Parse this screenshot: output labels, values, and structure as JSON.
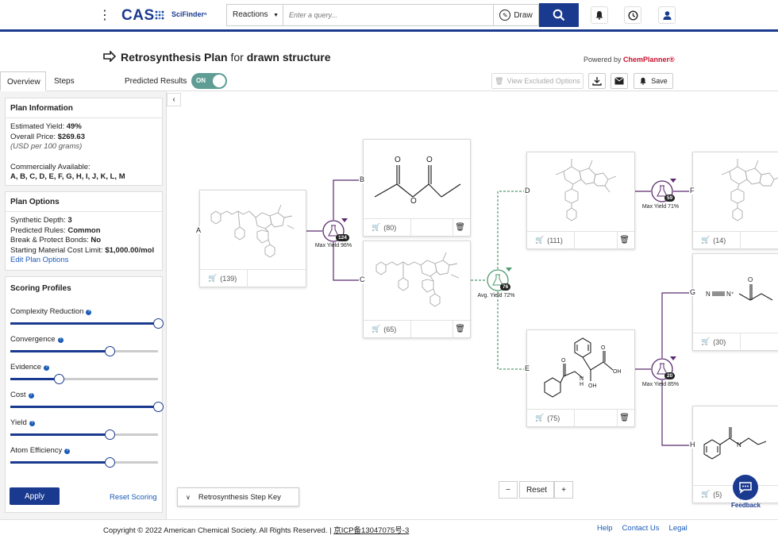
{
  "header": {
    "logo": "CAS",
    "logo_sub": "SciFinderⁿ",
    "search_type": "Reactions",
    "search_placeholder": "Enter a query...",
    "draw_label": "Draw"
  },
  "page": {
    "title_bold": "Retrosynthesis Plan",
    "title_mid": " for ",
    "title_end": "drawn structure",
    "powered_prefix": "Powered by ",
    "powered_brand": "ChemPlanner®"
  },
  "tabs": [
    {
      "label": "Overview"
    },
    {
      "label": "Steps"
    }
  ],
  "toolbar": {
    "predicted_label": "Predicted Results",
    "toggle_label": "ON",
    "view_excluded": "View Excluded Options",
    "save_label": "Save"
  },
  "plan_info": {
    "heading": "Plan Information",
    "est_yield_label": "Estimated Yield: ",
    "est_yield": "49%",
    "price_label": "Overall Price: ",
    "price": "$269.63",
    "price_note": "(USD per 100 grams)",
    "commercial_label": "Commercially Available:",
    "commercial": "A, B, C, D, E, F, G, H, I, J, K, L, M"
  },
  "plan_options": {
    "heading": "Plan Options",
    "depth_label": "Synthetic Depth: ",
    "depth": "3",
    "rules_label": "Predicted Rules: ",
    "rules": "Common",
    "bonds_label": "Break & Protect Bonds: ",
    "bonds": "No",
    "cost_label": "Starting Material Cost Limit: ",
    "cost": "$1,000.00/mol",
    "edit_link": "Edit Plan Options"
  },
  "scoring": {
    "heading": "Scoring Profiles",
    "sliders": [
      {
        "label": "Complexity Reduction",
        "value": 1.0
      },
      {
        "label": "Convergence",
        "value": 0.67
      },
      {
        "label": "Evidence",
        "value": 0.33
      },
      {
        "label": "Cost",
        "value": 1.0
      },
      {
        "label": "Yield",
        "value": 0.67
      },
      {
        "label": "Atom Efficiency",
        "value": 0.67
      }
    ],
    "apply_label": "Apply",
    "reset_label": "Reset Scoring"
  },
  "nodes": {
    "A": {
      "letter": "A",
      "count": "(139)"
    },
    "B": {
      "letter": "B",
      "count": "(80)"
    },
    "C": {
      "letter": "C",
      "count": "(65)"
    },
    "D": {
      "letter": "D",
      "count": "(111)"
    },
    "E": {
      "letter": "E",
      "count": "(75)"
    },
    "F": {
      "letter": "F",
      "count": "(14)"
    },
    "G": {
      "letter": "G",
      "count": "(30)"
    },
    "H": {
      "letter": "H",
      "count": "(5)"
    }
  },
  "reactions": [
    {
      "badge": "124",
      "label": "Max Yield 96%"
    },
    {
      "badge": "76",
      "label": "Avg. Yield 72%"
    },
    {
      "badge": "59",
      "label": "Max Yield 71%"
    },
    {
      "badge": "20",
      "label": "Max Yield 85%"
    }
  ],
  "molecule_labels": {
    "oh1": "OH",
    "oh2": "OH",
    "n1": "N",
    "n2": "N",
    "h1": "H",
    "n3": "N",
    "n4": "N⁺",
    "o1": "O",
    "o2": "O",
    "o3": "O",
    "o4": "O",
    "o5": "O",
    "o6": "O"
  },
  "controls": {
    "reset_label": "Reset",
    "step_key_label": "Retrosynthesis Step Key",
    "feedback_label": "Feedback"
  },
  "footer": {
    "copyright": "Copyright © 2022 American Chemical Society. All Rights Reserved. | ",
    "icp": "京ICP备13047075号-3",
    "links": [
      "Help",
      "Contact Us",
      "Legal"
    ]
  },
  "colors": {
    "brand": "#1a3a8f",
    "purple": "#5b2a6e",
    "green": "#4f9a6f",
    "toggle": "#5f9c94"
  }
}
